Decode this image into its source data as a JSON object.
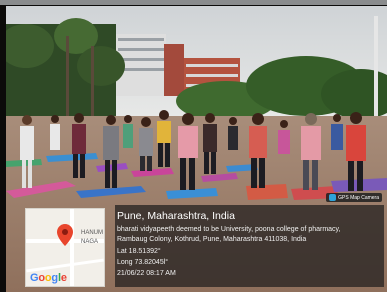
{
  "overlay": {
    "location_title": "Pune, Maharashtra, India",
    "address_line1": "bharati vidyapeeth deemed to be University, poona college of pharmacy,",
    "address_line2": "Rambaug Colony, Kothrud, Pune, Maharashtra 411038, India",
    "latitude": "Lat 18.51392°",
    "longitude": "Long 73.82045l°",
    "datetime": "21/06/22 08:17 AM",
    "badge_label": "GPS Map Camera"
  },
  "map": {
    "label_line1": "HANUM",
    "label_line2": "NAGA",
    "logo_text": "Google",
    "logo_colors": [
      "#4285F4",
      "#EA4335",
      "#FBBC05",
      "#4285F4",
      "#34A853",
      "#EA4335"
    ],
    "pin_color": "#e8452c",
    "pin_icon": "map-pin-icon"
  }
}
